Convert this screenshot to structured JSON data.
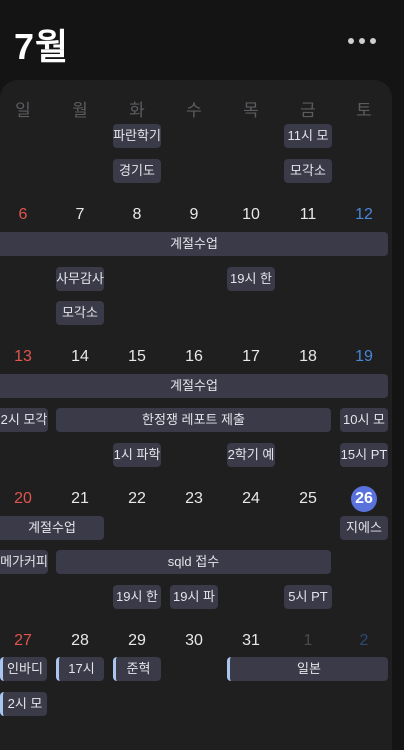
{
  "header": {
    "title": "7월"
  },
  "weekdays": [
    "일",
    "월",
    "화",
    "수",
    "목",
    "금",
    "토"
  ],
  "weeks": [
    {
      "dates": []
    },
    {
      "dates": [
        "6",
        "7",
        "8",
        "9",
        "10",
        "11",
        "12"
      ]
    },
    {
      "dates": [
        "13",
        "14",
        "15",
        "16",
        "17",
        "18",
        "19"
      ]
    },
    {
      "dates": [
        "20",
        "21",
        "22",
        "23",
        "24",
        "25",
        "26"
      ]
    },
    {
      "dates": [
        "27",
        "28",
        "29",
        "30",
        "31",
        "1",
        "2"
      ]
    }
  ],
  "events": {
    "w0": [
      "파란학기",
      "11시 모",
      "경기도",
      "모각소"
    ],
    "w1": [
      "계절수업",
      "사무감사",
      "19시 한",
      "모각소"
    ],
    "w2": [
      "계절수업",
      "2시 모각",
      "한정쟁 레포트 제출",
      "10시 모",
      "1시 파학",
      "2학기 예",
      "15시 PT"
    ],
    "w3": [
      "계절수업",
      "지에스",
      "메가커피",
      "sqld 접수",
      "19시 한",
      "19시 파",
      "5시 PT"
    ],
    "w4": [
      "인바디",
      "17시",
      "준혁",
      "일본",
      "2시 모"
    ]
  },
  "colors": {
    "sunday": "#e0554d",
    "saturday": "#4a86d8",
    "today": "#5a73dc",
    "event_bg": "#3a3a48",
    "accent_bar": "#aac6ee"
  }
}
